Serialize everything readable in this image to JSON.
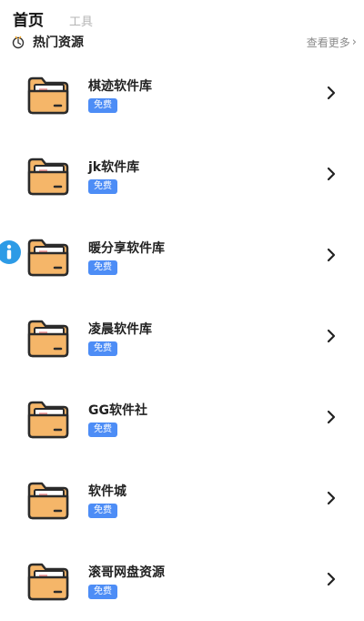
{
  "tabs": [
    {
      "label": "首页",
      "active": true
    },
    {
      "label": "工具",
      "active": false
    }
  ],
  "section": {
    "title": "热门资源",
    "more_label": "查看更多",
    "icon": "hot-icon"
  },
  "items": [
    {
      "name": "棋迹软件库",
      "badge": "免费"
    },
    {
      "name": "jk软件库",
      "badge": "免费"
    },
    {
      "name": "暖分享软件库",
      "badge": "免费"
    },
    {
      "name": "凌晨软件库",
      "badge": "免费"
    },
    {
      "name": "GG软件社",
      "badge": "免费"
    },
    {
      "name": "软件城",
      "badge": "免费"
    },
    {
      "name": "滚哥网盘资源",
      "badge": "免费"
    }
  ],
  "colors": {
    "accent": "#4d8df6",
    "folder": "#f5b669",
    "folder_outline": "#2b2b2b",
    "info_icon": "#2d9be6"
  },
  "icons": {
    "item_icon": "folder-icon",
    "row_action": "chevron-right-icon",
    "floating": "info-icon"
  }
}
